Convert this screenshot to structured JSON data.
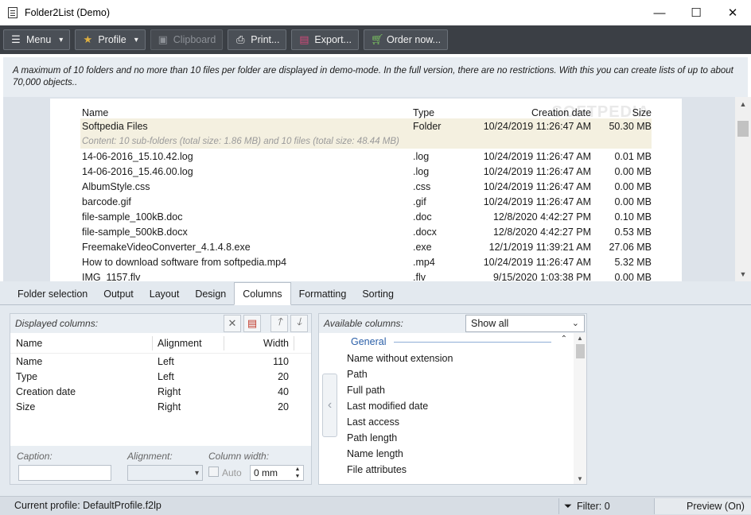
{
  "window": {
    "title": "Folder2List (Demo)",
    "controls": {
      "minimize": "—",
      "maximize": "☐",
      "close": "✕"
    }
  },
  "toolbar": {
    "menu_label": "Menu",
    "profile_label": "Profile",
    "clipboard_label": "Clipboard",
    "print_label": "Print...",
    "export_label": "Export...",
    "order_label": "Order now..."
  },
  "banner": {
    "text": "A maximum of 10 folders and no more than 10 files per folder are displayed in demo-mode. In the full version, there are no restrictions. With this you can create lists of up to about 70,000 objects.."
  },
  "preview": {
    "watermark": "SOFTPEDIA",
    "headers": {
      "name": "Name",
      "type": "Type",
      "date": "Creation date",
      "size": "Size"
    },
    "folder": {
      "name": "Softpedia Files",
      "type": "Folder",
      "date": "10/24/2019 11:26:47 AM",
      "size": "50.30 MB",
      "content": "Content: 10 sub-folders (total size: 1.86 MB) and 10 files (total size: 48.44 MB)"
    },
    "rows": [
      {
        "name": "14-06-2016_15.10.42.log",
        "type": ".log",
        "date": "10/24/2019 11:26:47 AM",
        "size": "0.01 MB"
      },
      {
        "name": "14-06-2016_15.46.00.log",
        "type": ".log",
        "date": "10/24/2019 11:26:47 AM",
        "size": "0.00 MB"
      },
      {
        "name": "AlbumStyle.css",
        "type": ".css",
        "date": "10/24/2019 11:26:47 AM",
        "size": "0.00 MB"
      },
      {
        "name": "barcode.gif",
        "type": ".gif",
        "date": "10/24/2019 11:26:47 AM",
        "size": "0.00 MB"
      },
      {
        "name": "file-sample_100kB.doc",
        "type": ".doc",
        "date": "12/8/2020 4:42:27 PM",
        "size": "0.10 MB"
      },
      {
        "name": "file-sample_500kB.docx",
        "type": ".docx",
        "date": "12/8/2020 4:42:27 PM",
        "size": "0.53 MB"
      },
      {
        "name": "FreemakeVideoConverter_4.1.4.8.exe",
        "type": ".exe",
        "date": "12/1/2019 11:39:21 AM",
        "size": "27.06 MB"
      },
      {
        "name": "How to download software from softpedia.mp4",
        "type": ".mp4",
        "date": "10/24/2019 11:26:47 AM",
        "size": "5.32 MB"
      },
      {
        "name": "IMG_1157.flv",
        "type": ".flv",
        "date": "9/15/2020 1:03:38 PM",
        "size": "0.00 MB"
      }
    ]
  },
  "tabs": [
    {
      "label": "Folder selection"
    },
    {
      "label": "Output"
    },
    {
      "label": "Layout"
    },
    {
      "label": "Design"
    },
    {
      "label": "Columns",
      "active": true
    },
    {
      "label": "Formatting"
    },
    {
      "label": "Sorting"
    }
  ],
  "displayed": {
    "title": "Displayed columns:",
    "headers": {
      "name": "Name",
      "alignment": "Alignment",
      "width": "Width"
    },
    "rows": [
      {
        "name": "Name",
        "alignment": "Left",
        "width": "110"
      },
      {
        "name": "Type",
        "alignment": "Left",
        "width": "20"
      },
      {
        "name": "Creation date",
        "alignment": "Right",
        "width": "40"
      },
      {
        "name": "Size",
        "alignment": "Right",
        "width": "20"
      }
    ],
    "props": {
      "caption_label": "Caption:",
      "caption_value": "",
      "alignment_label": "Alignment:",
      "alignment_value": "",
      "width_label": "Column width:",
      "auto_label": "Auto",
      "width_value": "0 mm"
    }
  },
  "available": {
    "title": "Available columns:",
    "filter_value": "Show all",
    "group": "General",
    "items": [
      "Name without extension",
      "Path",
      "Full path",
      "Last modified date",
      "Last access",
      "Path length",
      "Name length",
      "File attributes"
    ]
  },
  "status": {
    "profile": "Current profile: DefaultProfile.f2lp",
    "filter": "Filter: 0",
    "preview": "Preview (On)"
  }
}
